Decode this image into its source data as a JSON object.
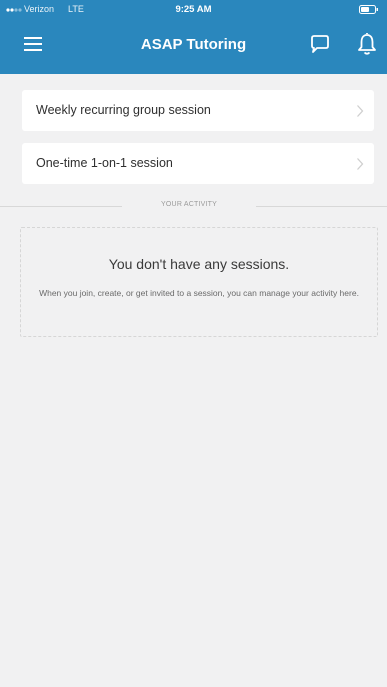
{
  "status_bar": {
    "carrier": "Verizon",
    "network": "LTE",
    "time": "9:25 AM"
  },
  "nav": {
    "title": "ASAP Tutoring",
    "menu_icon": "hamburger-menu-icon",
    "chat_icon": "chat-bubble-icon",
    "bell_icon": "bell-icon"
  },
  "options": [
    {
      "label": "Weekly recurring group session"
    },
    {
      "label": "One-time 1-on-1 session"
    }
  ],
  "activity": {
    "section_label": "YOUR ACTIVITY",
    "empty_title": "You don't have any sessions.",
    "empty_description": "When you join, create, or get invited to a session, you can manage your activity here."
  },
  "colors": {
    "header": "#2a87bd",
    "background": "#f1f1f2",
    "card": "#ffffff"
  }
}
